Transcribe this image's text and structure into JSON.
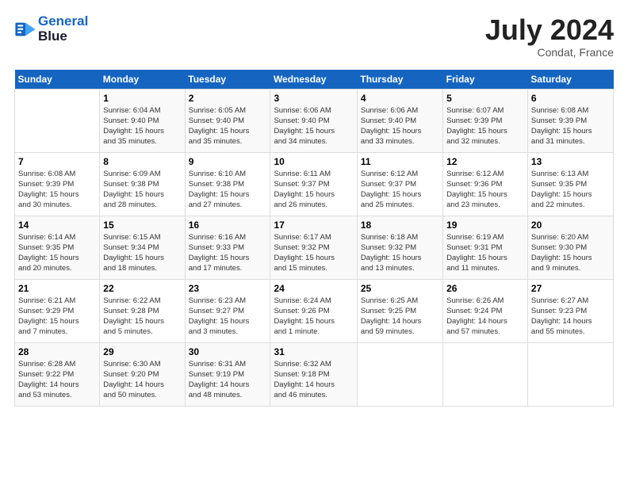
{
  "header": {
    "logo_line1": "General",
    "logo_line2": "Blue",
    "month_year": "July 2024",
    "location": "Condat, France"
  },
  "days_of_week": [
    "Sunday",
    "Monday",
    "Tuesday",
    "Wednesday",
    "Thursday",
    "Friday",
    "Saturday"
  ],
  "weeks": [
    [
      {
        "day": "",
        "info": ""
      },
      {
        "day": "1",
        "info": "Sunrise: 6:04 AM\nSunset: 9:40 PM\nDaylight: 15 hours\nand 35 minutes."
      },
      {
        "day": "2",
        "info": "Sunrise: 6:05 AM\nSunset: 9:40 PM\nDaylight: 15 hours\nand 35 minutes."
      },
      {
        "day": "3",
        "info": "Sunrise: 6:06 AM\nSunset: 9:40 PM\nDaylight: 15 hours\nand 34 minutes."
      },
      {
        "day": "4",
        "info": "Sunrise: 6:06 AM\nSunset: 9:40 PM\nDaylight: 15 hours\nand 33 minutes."
      },
      {
        "day": "5",
        "info": "Sunrise: 6:07 AM\nSunset: 9:39 PM\nDaylight: 15 hours\nand 32 minutes."
      },
      {
        "day": "6",
        "info": "Sunrise: 6:08 AM\nSunset: 9:39 PM\nDaylight: 15 hours\nand 31 minutes."
      }
    ],
    [
      {
        "day": "7",
        "info": "Sunrise: 6:08 AM\nSunset: 9:39 PM\nDaylight: 15 hours\nand 30 minutes."
      },
      {
        "day": "8",
        "info": "Sunrise: 6:09 AM\nSunset: 9:38 PM\nDaylight: 15 hours\nand 28 minutes."
      },
      {
        "day": "9",
        "info": "Sunrise: 6:10 AM\nSunset: 9:38 PM\nDaylight: 15 hours\nand 27 minutes."
      },
      {
        "day": "10",
        "info": "Sunrise: 6:11 AM\nSunset: 9:37 PM\nDaylight: 15 hours\nand 26 minutes."
      },
      {
        "day": "11",
        "info": "Sunrise: 6:12 AM\nSunset: 9:37 PM\nDaylight: 15 hours\nand 25 minutes."
      },
      {
        "day": "12",
        "info": "Sunrise: 6:12 AM\nSunset: 9:36 PM\nDaylight: 15 hours\nand 23 minutes."
      },
      {
        "day": "13",
        "info": "Sunrise: 6:13 AM\nSunset: 9:35 PM\nDaylight: 15 hours\nand 22 minutes."
      }
    ],
    [
      {
        "day": "14",
        "info": "Sunrise: 6:14 AM\nSunset: 9:35 PM\nDaylight: 15 hours\nand 20 minutes."
      },
      {
        "day": "15",
        "info": "Sunrise: 6:15 AM\nSunset: 9:34 PM\nDaylight: 15 hours\nand 18 minutes."
      },
      {
        "day": "16",
        "info": "Sunrise: 6:16 AM\nSunset: 9:33 PM\nDaylight: 15 hours\nand 17 minutes."
      },
      {
        "day": "17",
        "info": "Sunrise: 6:17 AM\nSunset: 9:32 PM\nDaylight: 15 hours\nand 15 minutes."
      },
      {
        "day": "18",
        "info": "Sunrise: 6:18 AM\nSunset: 9:32 PM\nDaylight: 15 hours\nand 13 minutes."
      },
      {
        "day": "19",
        "info": "Sunrise: 6:19 AM\nSunset: 9:31 PM\nDaylight: 15 hours\nand 11 minutes."
      },
      {
        "day": "20",
        "info": "Sunrise: 6:20 AM\nSunset: 9:30 PM\nDaylight: 15 hours\nand 9 minutes."
      }
    ],
    [
      {
        "day": "21",
        "info": "Sunrise: 6:21 AM\nSunset: 9:29 PM\nDaylight: 15 hours\nand 7 minutes."
      },
      {
        "day": "22",
        "info": "Sunrise: 6:22 AM\nSunset: 9:28 PM\nDaylight: 15 hours\nand 5 minutes."
      },
      {
        "day": "23",
        "info": "Sunrise: 6:23 AM\nSunset: 9:27 PM\nDaylight: 15 hours\nand 3 minutes."
      },
      {
        "day": "24",
        "info": "Sunrise: 6:24 AM\nSunset: 9:26 PM\nDaylight: 15 hours\nand 1 minute."
      },
      {
        "day": "25",
        "info": "Sunrise: 6:25 AM\nSunset: 9:25 PM\nDaylight: 14 hours\nand 59 minutes."
      },
      {
        "day": "26",
        "info": "Sunrise: 6:26 AM\nSunset: 9:24 PM\nDaylight: 14 hours\nand 57 minutes."
      },
      {
        "day": "27",
        "info": "Sunrise: 6:27 AM\nSunset: 9:23 PM\nDaylight: 14 hours\nand 55 minutes."
      }
    ],
    [
      {
        "day": "28",
        "info": "Sunrise: 6:28 AM\nSunset: 9:22 PM\nDaylight: 14 hours\nand 53 minutes."
      },
      {
        "day": "29",
        "info": "Sunrise: 6:30 AM\nSunset: 9:20 PM\nDaylight: 14 hours\nand 50 minutes."
      },
      {
        "day": "30",
        "info": "Sunrise: 6:31 AM\nSunset: 9:19 PM\nDaylight: 14 hours\nand 48 minutes."
      },
      {
        "day": "31",
        "info": "Sunrise: 6:32 AM\nSunset: 9:18 PM\nDaylight: 14 hours\nand 46 minutes."
      },
      {
        "day": "",
        "info": ""
      },
      {
        "day": "",
        "info": ""
      },
      {
        "day": "",
        "info": ""
      }
    ]
  ]
}
